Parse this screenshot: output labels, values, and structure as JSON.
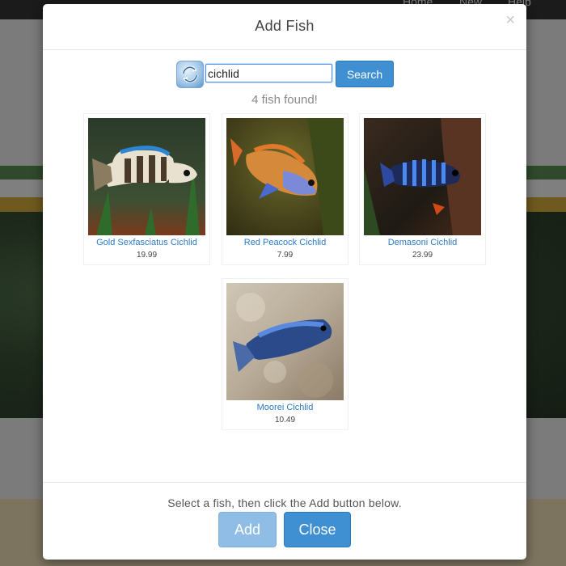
{
  "background_nav": {
    "items": [
      "Home",
      "New",
      "Help"
    ]
  },
  "modal": {
    "title": "Add Fish",
    "close_glyph": "×"
  },
  "search": {
    "refresh_icon": "refresh-icon",
    "query": "cichlid",
    "button_label": "Search"
  },
  "results": {
    "summary": "4 fish found!",
    "fish": [
      {
        "name": "Gold Sexfasciatus Cichlid",
        "price": "19.99"
      },
      {
        "name": "Red Peacock Cichlid",
        "price": "7.99"
      },
      {
        "name": "Demasoni Cichlid",
        "price": "23.99"
      },
      {
        "name": "Moorei Cichlid",
        "price": "10.49"
      }
    ]
  },
  "footer": {
    "instruction": "Select a fish, then click the Add button below.",
    "add_label": "Add",
    "close_label": "Close"
  },
  "colors": {
    "primary": "#3f8fd3",
    "primary_disabled": "#8fbde6",
    "link": "#2a7ac7"
  }
}
